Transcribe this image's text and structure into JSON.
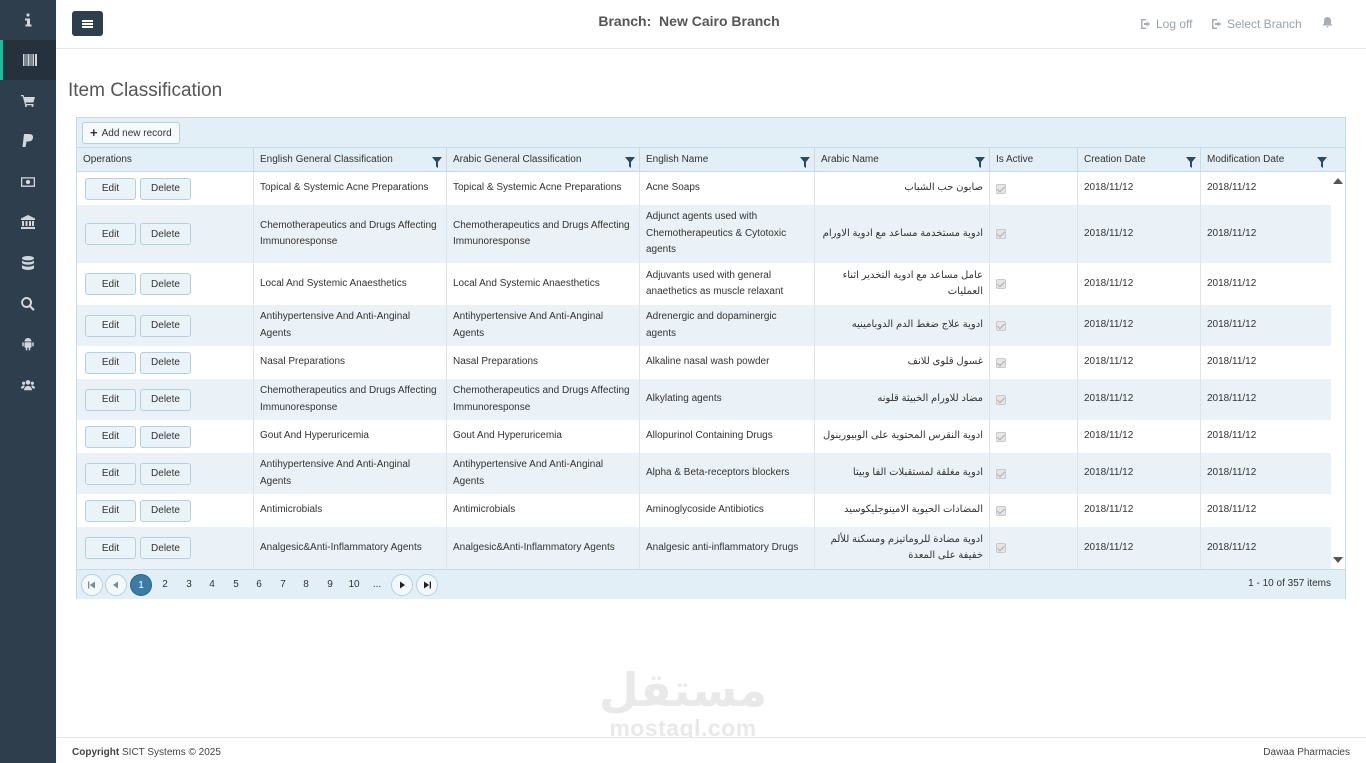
{
  "header": {
    "branch_label": "Branch:",
    "branch_name": "New Cairo Branch",
    "log_off": "Log off",
    "select_branch": "Select Branch"
  },
  "page": {
    "title": "Item Classification"
  },
  "grid": {
    "add_label": "Add new record",
    "columns": [
      "Operations",
      "English General Classification",
      "Arabic General Classification",
      "English Name",
      "Arabic Name",
      "Is Active",
      "Creation Date",
      "Modification Date"
    ],
    "edit_label": "Edit",
    "delete_label": "Delete",
    "rows": [
      {
        "eng_general": "Topical & Systemic Acne Preparations",
        "ar_general": "Topical & Systemic Acne Preparations",
        "eng_name": "Acne Soaps",
        "ar_name": "صابون حب الشباب",
        "active": true,
        "created": "2018/11/12",
        "modified": "2018/11/12"
      },
      {
        "eng_general": "Chemotherapeutics and Drugs Affecting Immunoresponse",
        "ar_general": "Chemotherapeutics and Drugs Affecting Immunoresponse",
        "eng_name": "Adjunct agents used with Chemotherapeutics & Cytotoxic agents",
        "ar_name": "ادوية مستخدمة مساعد مع ادوية الاورام",
        "active": true,
        "created": "2018/11/12",
        "modified": "2018/11/12"
      },
      {
        "eng_general": "Local And Systemic Anaesthetics",
        "ar_general": "Local And Systemic Anaesthetics",
        "eng_name": "Adjuvants used with general anaethetics as muscle relaxant",
        "ar_name": "عامل مساعد مع ادوية التخدير اثناء العمليات",
        "active": true,
        "created": "2018/11/12",
        "modified": "2018/11/12"
      },
      {
        "eng_general": "Antihypertensive And Anti-Anginal Agents",
        "ar_general": "Antihypertensive And Anti-Anginal Agents",
        "eng_name": "Adrenergic and dopaminergic agents",
        "ar_name": "ادوية علاج ضغط الدم الدوبامينيه",
        "active": true,
        "created": "2018/11/12",
        "modified": "2018/11/12"
      },
      {
        "eng_general": "Nasal Preparations",
        "ar_general": "Nasal Preparations",
        "eng_name": "Alkaline nasal wash powder",
        "ar_name": "غسول قلوى للانف",
        "active": true,
        "created": "2018/11/12",
        "modified": "2018/11/12"
      },
      {
        "eng_general": "Chemotherapeutics and Drugs Affecting Immunoresponse",
        "ar_general": "Chemotherapeutics and Drugs Affecting Immunoresponse",
        "eng_name": "Alkylating agents",
        "ar_name": "مضاد للاورام الخبيثة قلونه",
        "active": true,
        "created": "2018/11/12",
        "modified": "2018/11/12"
      },
      {
        "eng_general": "Gout And Hyperuricemia",
        "ar_general": "Gout And Hyperuricemia",
        "eng_name": "Allopurinol Containing Drugs",
        "ar_name": "ادوية النقرس المحتوية على الوبيورينول",
        "active": true,
        "created": "2018/11/12",
        "modified": "2018/11/12"
      },
      {
        "eng_general": "Antihypertensive And Anti-Anginal Agents",
        "ar_general": "Antihypertensive And Anti-Anginal Agents",
        "eng_name": "Alpha & Beta-receptors blockers",
        "ar_name": "ادوية مغلقة لمستقبلات الفا وبيتا",
        "active": true,
        "created": "2018/11/12",
        "modified": "2018/11/12"
      },
      {
        "eng_general": "Antimicrobials",
        "ar_general": "Antimicrobials",
        "eng_name": "Aminoglycoside Antibiotics",
        "ar_name": "المضادات الحيوية الامينوجليكوسيد",
        "active": true,
        "created": "2018/11/12",
        "modified": "2018/11/12"
      },
      {
        "eng_general": "Analgesic&Anti-Inflammatory Agents",
        "ar_general": "Analgesic&Anti-Inflammatory Agents",
        "eng_name": "Analgesic anti-inflammatory Drugs",
        "ar_name": "ادوية مضادة للروماتيزم ومسكنة للألم خفيفة على المعدة",
        "active": true,
        "created": "2018/11/12",
        "modified": "2018/11/12"
      }
    ]
  },
  "pager": {
    "pages": [
      "1",
      "2",
      "3",
      "4",
      "5",
      "6",
      "7",
      "8",
      "9",
      "10",
      "..."
    ],
    "current": "1",
    "info": "1 - 10 of 357 items"
  },
  "watermark": {
    "arabic": "مستقل",
    "latin": "mostaql.com"
  },
  "footer": {
    "copyright_bold": "Copyright",
    "copyright_rest": " SICT Systems © 2025",
    "brand": "Dawaa Pharmacies"
  },
  "icons": {
    "sidebar": [
      "info-icon",
      "barcode-icon",
      "cart-icon",
      "paypal-icon",
      "money-icon",
      "bank-icon",
      "database-icon",
      "search-icon",
      "android-icon",
      "users-icon"
    ],
    "accent": "#1bbc9b",
    "sidebar_bg": "#2f3e4c"
  }
}
